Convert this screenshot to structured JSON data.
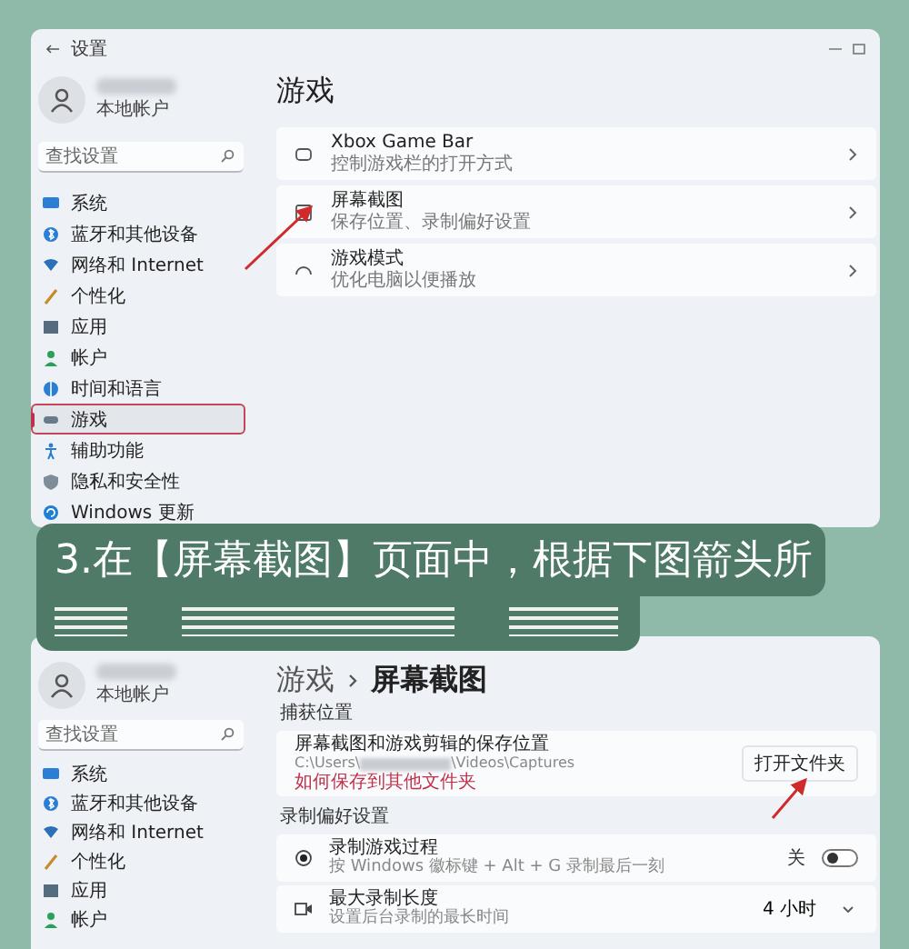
{
  "top_window": {
    "title": "设置",
    "account": "本地帐户",
    "search": {
      "placeholder": "查找设置"
    },
    "nav": [
      {
        "label": "系统",
        "selected": false,
        "highlighted": false
      },
      {
        "label": "蓝牙和其他设备",
        "selected": false,
        "highlighted": false
      },
      {
        "label": "网络和 Internet",
        "selected": false,
        "highlighted": false
      },
      {
        "label": "个性化",
        "selected": false,
        "highlighted": false
      },
      {
        "label": "应用",
        "selected": false,
        "highlighted": false
      },
      {
        "label": "帐户",
        "selected": false,
        "highlighted": false
      },
      {
        "label": "时间和语言",
        "selected": false,
        "highlighted": false
      },
      {
        "label": "游戏",
        "selected": true,
        "highlighted": true
      },
      {
        "label": "辅助功能",
        "selected": false,
        "highlighted": false
      },
      {
        "label": "隐私和安全性",
        "selected": false,
        "highlighted": false
      },
      {
        "label": "Windows 更新",
        "selected": false,
        "highlighted": false
      }
    ],
    "heading": "游戏",
    "cards": [
      {
        "title": "Xbox Game Bar",
        "subtitle": "控制游戏栏的打开方式"
      },
      {
        "title": "屏幕截图",
        "subtitle": "保存位置、录制偏好设置"
      },
      {
        "title": "游戏模式",
        "subtitle": "优化电脑以便播放"
      }
    ]
  },
  "caption": {
    "text": "3.在【屏幕截图】页面中，根据下图箭头所"
  },
  "bottom_window": {
    "account": "本地帐户",
    "search": {
      "placeholder": "查找设置"
    },
    "nav": [
      {
        "label": "系统"
      },
      {
        "label": "蓝牙和其他设备"
      },
      {
        "label": "网络和 Internet"
      },
      {
        "label": "个性化"
      },
      {
        "label": "应用"
      },
      {
        "label": "帐户"
      }
    ],
    "breadcrumb": [
      "游戏",
      "屏幕截图"
    ],
    "capture_section": {
      "label": "捕获位置",
      "title": "屏幕截图和游戏剪辑的保存位置",
      "path_start": "C:\\Users\\",
      "path_end": "\\Videos\\Captures",
      "note": "如何保存到其他文件夹",
      "button": "打开文件夹"
    },
    "recording_section": {
      "label": "录制偏好设置",
      "rows": [
        {
          "kind": "toggle",
          "title": "录制游戏过程",
          "subtitle": "按 Windows 徽标键 + Alt + G 录制最后一刻",
          "value": "关",
          "on": false
        },
        {
          "kind": "dropdown",
          "title": "最大录制长度",
          "subtitle": "设置后台录制的最长时间",
          "value": "4 小时"
        }
      ]
    }
  }
}
